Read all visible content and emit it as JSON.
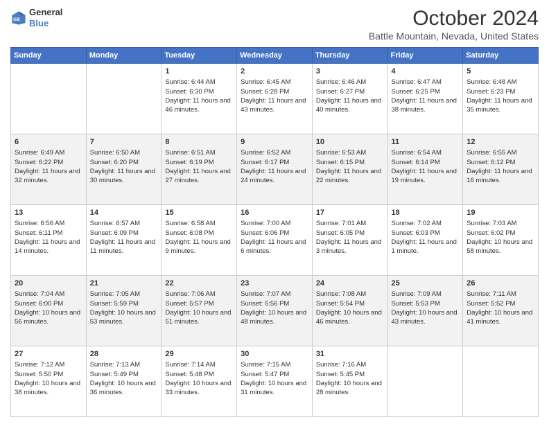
{
  "header": {
    "logo_line1": "General",
    "logo_line2": "Blue",
    "title": "October 2024",
    "subtitle": "Battle Mountain, Nevada, United States"
  },
  "days_of_week": [
    "Sunday",
    "Monday",
    "Tuesday",
    "Wednesday",
    "Thursday",
    "Friday",
    "Saturday"
  ],
  "weeks": [
    [
      {
        "day": "",
        "sunrise": "",
        "sunset": "",
        "daylight": ""
      },
      {
        "day": "",
        "sunrise": "",
        "sunset": "",
        "daylight": ""
      },
      {
        "day": "1",
        "sunrise": "Sunrise: 6:44 AM",
        "sunset": "Sunset: 6:30 PM",
        "daylight": "Daylight: 11 hours and 46 minutes."
      },
      {
        "day": "2",
        "sunrise": "Sunrise: 6:45 AM",
        "sunset": "Sunset: 6:28 PM",
        "daylight": "Daylight: 11 hours and 43 minutes."
      },
      {
        "day": "3",
        "sunrise": "Sunrise: 6:46 AM",
        "sunset": "Sunset: 6:27 PM",
        "daylight": "Daylight: 11 hours and 40 minutes."
      },
      {
        "day": "4",
        "sunrise": "Sunrise: 6:47 AM",
        "sunset": "Sunset: 6:25 PM",
        "daylight": "Daylight: 11 hours and 38 minutes."
      },
      {
        "day": "5",
        "sunrise": "Sunrise: 6:48 AM",
        "sunset": "Sunset: 6:23 PM",
        "daylight": "Daylight: 11 hours and 35 minutes."
      }
    ],
    [
      {
        "day": "6",
        "sunrise": "Sunrise: 6:49 AM",
        "sunset": "Sunset: 6:22 PM",
        "daylight": "Daylight: 11 hours and 32 minutes."
      },
      {
        "day": "7",
        "sunrise": "Sunrise: 6:50 AM",
        "sunset": "Sunset: 6:20 PM",
        "daylight": "Daylight: 11 hours and 30 minutes."
      },
      {
        "day": "8",
        "sunrise": "Sunrise: 6:51 AM",
        "sunset": "Sunset: 6:19 PM",
        "daylight": "Daylight: 11 hours and 27 minutes."
      },
      {
        "day": "9",
        "sunrise": "Sunrise: 6:52 AM",
        "sunset": "Sunset: 6:17 PM",
        "daylight": "Daylight: 11 hours and 24 minutes."
      },
      {
        "day": "10",
        "sunrise": "Sunrise: 6:53 AM",
        "sunset": "Sunset: 6:15 PM",
        "daylight": "Daylight: 11 hours and 22 minutes."
      },
      {
        "day": "11",
        "sunrise": "Sunrise: 6:54 AM",
        "sunset": "Sunset: 6:14 PM",
        "daylight": "Daylight: 11 hours and 19 minutes."
      },
      {
        "day": "12",
        "sunrise": "Sunrise: 6:55 AM",
        "sunset": "Sunset: 6:12 PM",
        "daylight": "Daylight: 11 hours and 16 minutes."
      }
    ],
    [
      {
        "day": "13",
        "sunrise": "Sunrise: 6:56 AM",
        "sunset": "Sunset: 6:11 PM",
        "daylight": "Daylight: 11 hours and 14 minutes."
      },
      {
        "day": "14",
        "sunrise": "Sunrise: 6:57 AM",
        "sunset": "Sunset: 6:09 PM",
        "daylight": "Daylight: 11 hours and 11 minutes."
      },
      {
        "day": "15",
        "sunrise": "Sunrise: 6:58 AM",
        "sunset": "Sunset: 6:08 PM",
        "daylight": "Daylight: 11 hours and 9 minutes."
      },
      {
        "day": "16",
        "sunrise": "Sunrise: 7:00 AM",
        "sunset": "Sunset: 6:06 PM",
        "daylight": "Daylight: 11 hours and 6 minutes."
      },
      {
        "day": "17",
        "sunrise": "Sunrise: 7:01 AM",
        "sunset": "Sunset: 6:05 PM",
        "daylight": "Daylight: 11 hours and 3 minutes."
      },
      {
        "day": "18",
        "sunrise": "Sunrise: 7:02 AM",
        "sunset": "Sunset: 6:03 PM",
        "daylight": "Daylight: 11 hours and 1 minute."
      },
      {
        "day": "19",
        "sunrise": "Sunrise: 7:03 AM",
        "sunset": "Sunset: 6:02 PM",
        "daylight": "Daylight: 10 hours and 58 minutes."
      }
    ],
    [
      {
        "day": "20",
        "sunrise": "Sunrise: 7:04 AM",
        "sunset": "Sunset: 6:00 PM",
        "daylight": "Daylight: 10 hours and 56 minutes."
      },
      {
        "day": "21",
        "sunrise": "Sunrise: 7:05 AM",
        "sunset": "Sunset: 5:59 PM",
        "daylight": "Daylight: 10 hours and 53 minutes."
      },
      {
        "day": "22",
        "sunrise": "Sunrise: 7:06 AM",
        "sunset": "Sunset: 5:57 PM",
        "daylight": "Daylight: 10 hours and 51 minutes."
      },
      {
        "day": "23",
        "sunrise": "Sunrise: 7:07 AM",
        "sunset": "Sunset: 5:56 PM",
        "daylight": "Daylight: 10 hours and 48 minutes."
      },
      {
        "day": "24",
        "sunrise": "Sunrise: 7:08 AM",
        "sunset": "Sunset: 5:54 PM",
        "daylight": "Daylight: 10 hours and 46 minutes."
      },
      {
        "day": "25",
        "sunrise": "Sunrise: 7:09 AM",
        "sunset": "Sunset: 5:53 PM",
        "daylight": "Daylight: 10 hours and 43 minutes."
      },
      {
        "day": "26",
        "sunrise": "Sunrise: 7:11 AM",
        "sunset": "Sunset: 5:52 PM",
        "daylight": "Daylight: 10 hours and 41 minutes."
      }
    ],
    [
      {
        "day": "27",
        "sunrise": "Sunrise: 7:12 AM",
        "sunset": "Sunset: 5:50 PM",
        "daylight": "Daylight: 10 hours and 38 minutes."
      },
      {
        "day": "28",
        "sunrise": "Sunrise: 7:13 AM",
        "sunset": "Sunset: 5:49 PM",
        "daylight": "Daylight: 10 hours and 36 minutes."
      },
      {
        "day": "29",
        "sunrise": "Sunrise: 7:14 AM",
        "sunset": "Sunset: 5:48 PM",
        "daylight": "Daylight: 10 hours and 33 minutes."
      },
      {
        "day": "30",
        "sunrise": "Sunrise: 7:15 AM",
        "sunset": "Sunset: 5:47 PM",
        "daylight": "Daylight: 10 hours and 31 minutes."
      },
      {
        "day": "31",
        "sunrise": "Sunrise: 7:16 AM",
        "sunset": "Sunset: 5:45 PM",
        "daylight": "Daylight: 10 hours and 28 minutes."
      },
      {
        "day": "",
        "sunrise": "",
        "sunset": "",
        "daylight": ""
      },
      {
        "day": "",
        "sunrise": "",
        "sunset": "",
        "daylight": ""
      }
    ]
  ]
}
